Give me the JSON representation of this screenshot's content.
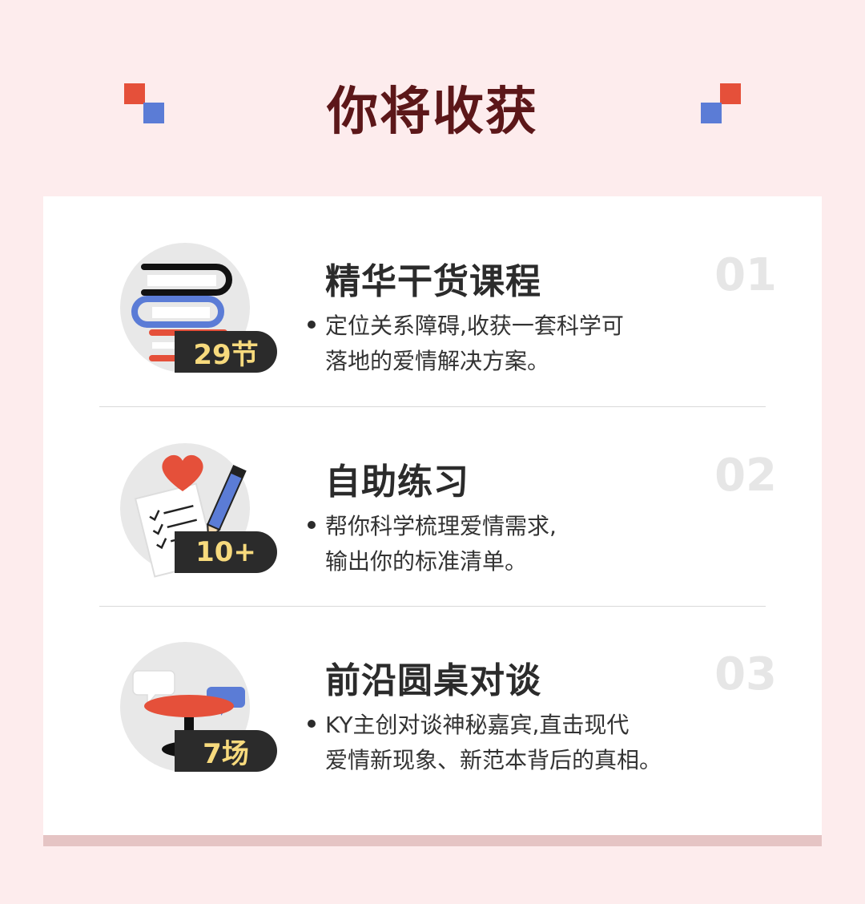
{
  "page": {
    "title": "你将收获",
    "colors": {
      "background": "#fdeced",
      "title": "#5c1719",
      "accent_red": "#e5503a",
      "accent_blue": "#5b7cd6",
      "badge_bg": "#2b2b2b",
      "badge_text": "#f7da7d"
    }
  },
  "items": [
    {
      "icon": "books-stack-icon",
      "badge": "29节",
      "title": "精华干货课程",
      "number": "01",
      "desc_line1": "定位关系障碍,收获一套科学可",
      "desc_line2": "落地的爱情解决方案。"
    },
    {
      "icon": "heart-checklist-pencil-icon",
      "badge": "10+",
      "title": "自助练习",
      "number": "02",
      "desc_line1": "帮你科学梳理爱情需求,",
      "desc_line2": "输出你的标准清单。"
    },
    {
      "icon": "round-table-chat-icon",
      "badge": "7场",
      "title": "前沿圆桌对谈",
      "number": "03",
      "desc_line1": "KY主创对谈神秘嘉宾,直击现代",
      "desc_line2": "爱情新现象、新范本背后的真相。"
    }
  ]
}
